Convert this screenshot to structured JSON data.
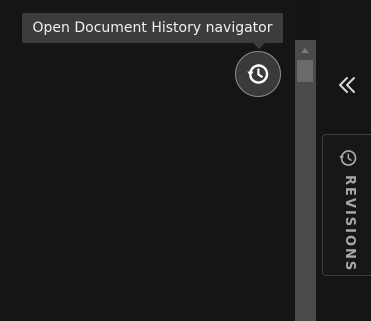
{
  "tooltip": {
    "text": "Open Document History navigator"
  },
  "history_button": {
    "icon": "history-icon"
  },
  "collapse_button": {
    "icon": "double-chevron-left-icon"
  },
  "revisions_tab": {
    "label": "REVISIONS",
    "icon": "history-icon"
  },
  "colors": {
    "background": "#141414",
    "tooltip_bg": "#3c3c3c",
    "scrollbar": "#4a4a4a",
    "text_muted": "#a8a8a8"
  }
}
